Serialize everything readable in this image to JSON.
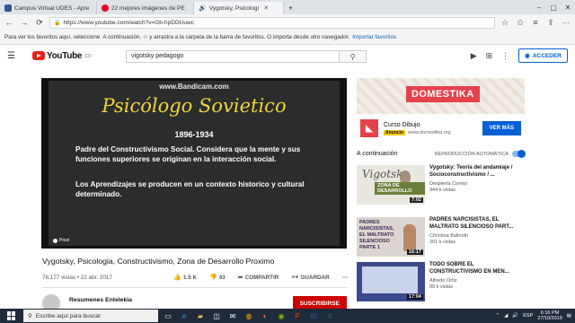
{
  "browser": {
    "tabs": [
      {
        "label": "Campus Virtual UDES - Apre",
        "color": "#2b5797",
        "active": false
      },
      {
        "label": "22 mejores imágenes de PE",
        "color": "#e60023",
        "active": false
      },
      {
        "label": "Vygotsky, Psicologí",
        "color": "#ff0000",
        "active": true
      }
    ],
    "url": "https://www.youtube.com/watch?v=Gb-hpDDUuwc",
    "favorites_text": "Para ver los favoritos aquí, seleccione",
    "favorites_hint": "A continuación, ☆ y arrastra a la carpeta de la barra de favoritos. O importa desde otro navegador.",
    "favorites_link": "Importar favoritos"
  },
  "youtube": {
    "logo_text": "YouTube",
    "logo_suffix": "CO",
    "search_query": "vigotsky pedagogo",
    "signin_label": "ACCEDER"
  },
  "video": {
    "slide": {
      "watermark": "www.Bandicam.com",
      "heading": "Psicólogo Sovietico",
      "years": "1896-1934",
      "paragraph1": "Padre del Constructivismo Social. Considera que la mente y sus funciones superiores se originan en la interacción social.",
      "paragraph2": "Los Aprendizajes se producen en un contexto historico y cultural determinado.",
      "badge": "Prezi"
    },
    "title": "Vygotsky, Psicologia, Constructivismo, Zona de Desarrollo Proximo",
    "views_date": "76,177 vistas • 22 abr. 2017",
    "likes": "1.5 K",
    "dislikes": "43",
    "share_label": "COMPARTIR",
    "save_label": "GUARDAR",
    "channel_name": "Resumenes Entelekia",
    "subscribe_label": "SUSCRIBIRSE"
  },
  "ad": {
    "banner_brand": "DOMESTIKA",
    "title": "Curso Dibujo",
    "tag": "Anuncio",
    "domain": "www.domestika.org",
    "cta": "VER MÁS"
  },
  "up_next": {
    "heading": "A continuación",
    "autoplay_label": "REPRODUCCIÓN AUTOMÁTICA",
    "items": [
      {
        "title": "Vygotsky: Teoría del andamiaje / Socioconstructivismo / ...",
        "channel": "Despierta Conejo",
        "views": "344 k vistas",
        "duration": "7:02",
        "thumb_word": "Vigotsky",
        "thumb_ribbon": "ZONA DE DESARROLLO"
      },
      {
        "title": "PADRES NARCISISTAS, EL MALTRATO SILENCIOSO PART...",
        "channel": "Christina Balinotti",
        "views": "301 k vistas",
        "duration": "16:17",
        "thumb_text": "PADRES NARCISISTAS, EL MALTRATO SILENCIOSO PARTE 1"
      },
      {
        "title": "TODO SOBRE EL CONSTRUCTIVISMO EN MEN...",
        "channel": "Alfredo Ortiz",
        "views": "89 k vistas",
        "duration": "17:04"
      }
    ]
  },
  "taskbar": {
    "search_placeholder": "Escribe aquí para buscar",
    "language": "ESP",
    "time": "6:16 PM",
    "date": "27/10/2019"
  },
  "colors": {
    "yt_red": "#ff0000",
    "link_blue": "#065fd4",
    "domestika": "#e6424b",
    "slide_title": "#f3d43a"
  }
}
